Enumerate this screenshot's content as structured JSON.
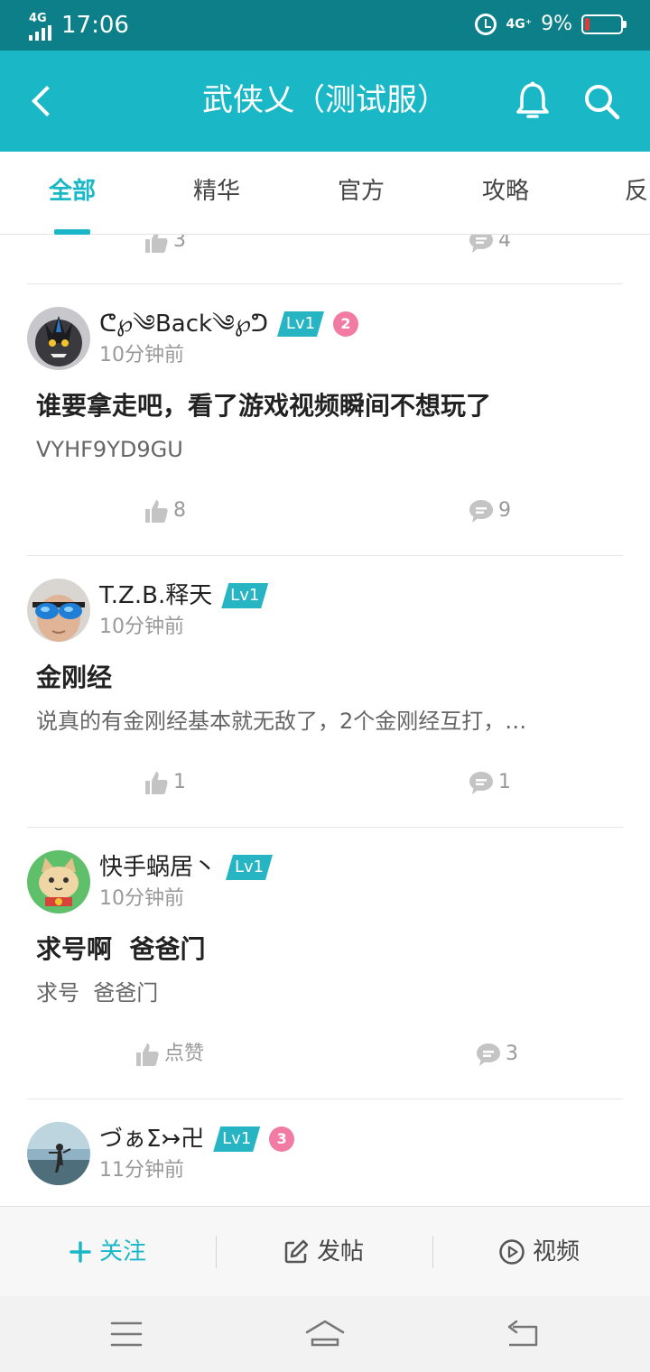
{
  "status_bar": {
    "network_label": "4G",
    "time": "17:06",
    "network_label_right": "4G⁺",
    "battery_percent_text": "9%",
    "battery_level": 0.09,
    "icons": [
      "signal-icon",
      "alarm-icon",
      "battery-icon"
    ]
  },
  "app_bar": {
    "title": "武侠乂（测试服）",
    "icons": [
      "back-icon",
      "bell-icon",
      "search-icon"
    ]
  },
  "tabs": [
    {
      "label": "全部",
      "active": true
    },
    {
      "label": "精华",
      "active": false
    },
    {
      "label": "官方",
      "active": false
    },
    {
      "label": "攻略",
      "active": false
    },
    {
      "label": "反",
      "active": false
    }
  ],
  "prev_post": {
    "likes": "3",
    "comments": "4"
  },
  "posts": [
    {
      "author": "ᕦ℘༄Back༄℘ᕤ",
      "level": "Lv1",
      "medal": "2",
      "time": "10分钟前",
      "title": "谁要拿走吧，看了游戏视频瞬间不想玩了",
      "body": "VYHF9YD9GU",
      "likes": "8",
      "comments": "9"
    },
    {
      "author": "T.Z.B.释天",
      "level": "Lv1",
      "time": "10分钟前",
      "title": "金刚经",
      "body": "说真的有金刚经基本就无敌了，2个金刚经互打，…",
      "likes": "1",
      "comments": "1"
    },
    {
      "author": "快手蜗居丶",
      "level": "Lv1",
      "time": "10分钟前",
      "title": "求号啊  爸爸门",
      "body": "求号  爸爸门",
      "likes": "点赞",
      "comments": "3"
    },
    {
      "author": "づぁΣ↣卍",
      "level": "Lv1",
      "medal": "3",
      "time": "11分钟前"
    }
  ],
  "bottom_bar": {
    "follow_label": "关注",
    "post_label": "发帖",
    "video_label": "视频",
    "icons": [
      "plus-icon",
      "edit-icon",
      "play-icon"
    ]
  },
  "nav_bar": {
    "icons": [
      "menu-icon",
      "home-icon",
      "back-nav-icon"
    ]
  },
  "colors": {
    "status_bar": "#0c7f88",
    "primary": "#1ab8c6",
    "level_badge": "#27b5c4",
    "medal": "#f27ba3",
    "battery_low": "#e53935"
  }
}
